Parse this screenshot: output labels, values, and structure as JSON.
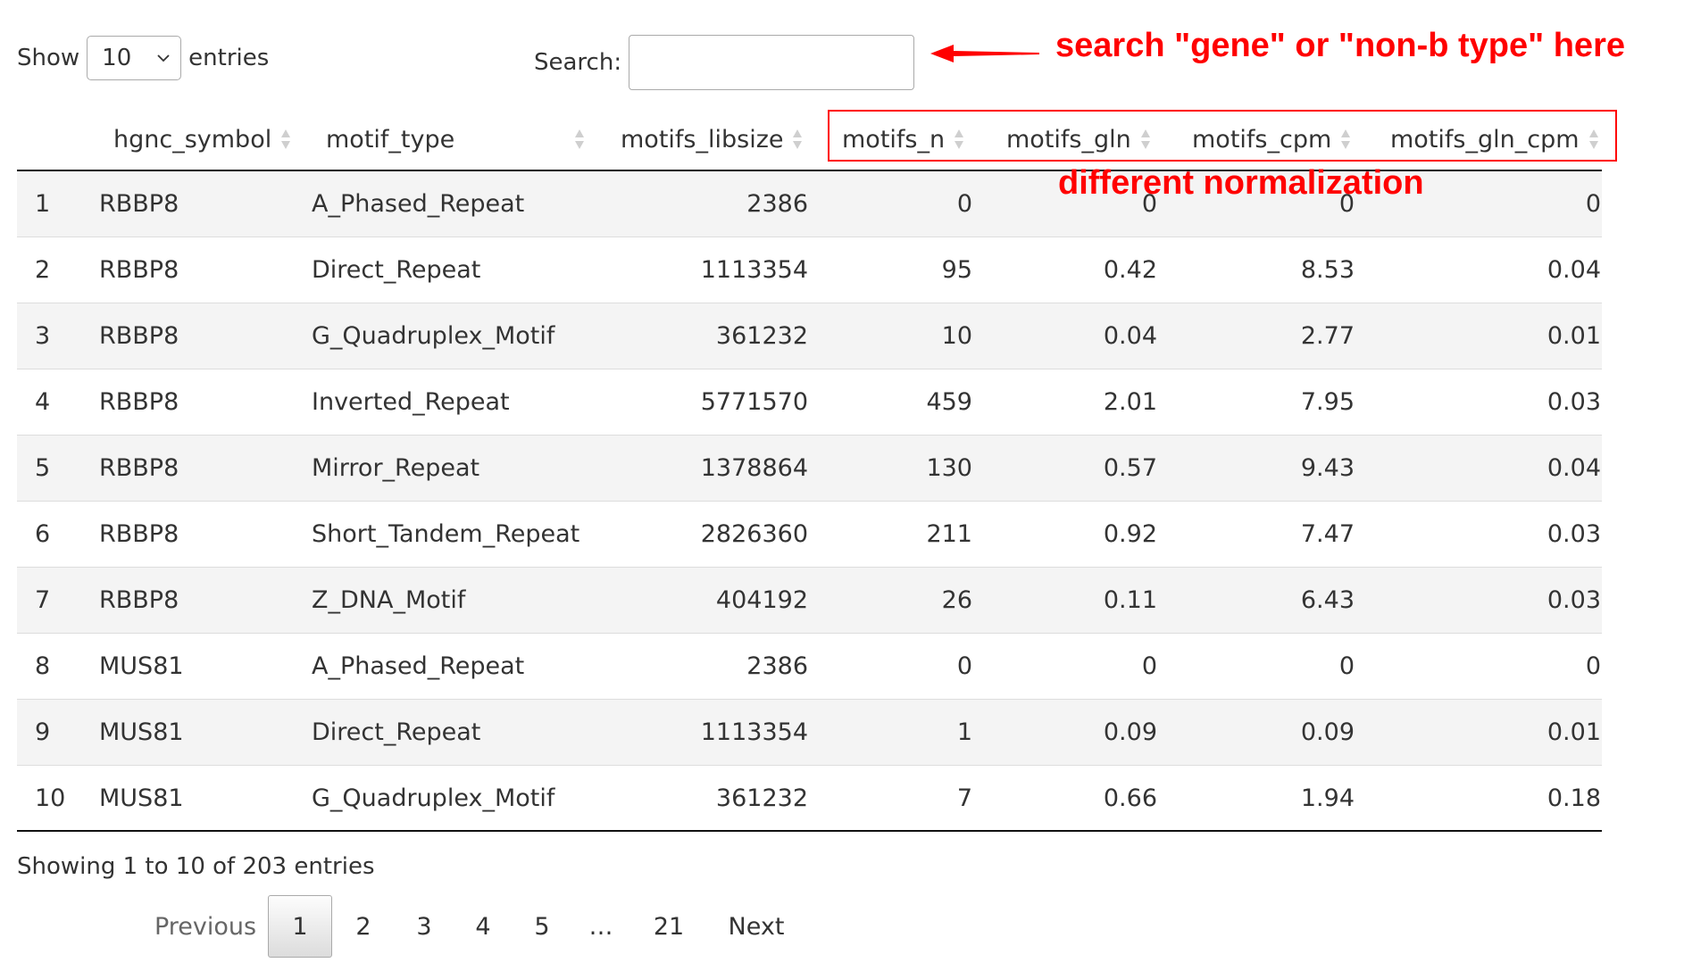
{
  "controls": {
    "show_label": "Show",
    "entries_value": "10",
    "entries_label": "entries",
    "search_label": "Search:",
    "search_value": ""
  },
  "annotations": {
    "search_note": "search \"gene\" or \"non-b type\" here",
    "normalization_note": "different normalization",
    "accent_color": "#ff0000"
  },
  "table": {
    "columns": [
      "",
      "hgnc_symbol",
      "motif_type",
      "motifs_libsize",
      "motifs_n",
      "motifs_gln",
      "motifs_cpm",
      "motifs_gln_cpm"
    ],
    "rows": [
      [
        "1",
        "RBBP8",
        "A_Phased_Repeat",
        "2386",
        "0",
        "0",
        "0",
        "0"
      ],
      [
        "2",
        "RBBP8",
        "Direct_Repeat",
        "1113354",
        "95",
        "0.42",
        "8.53",
        "0.04"
      ],
      [
        "3",
        "RBBP8",
        "G_Quadruplex_Motif",
        "361232",
        "10",
        "0.04",
        "2.77",
        "0.01"
      ],
      [
        "4",
        "RBBP8",
        "Inverted_Repeat",
        "5771570",
        "459",
        "2.01",
        "7.95",
        "0.03"
      ],
      [
        "5",
        "RBBP8",
        "Mirror_Repeat",
        "1378864",
        "130",
        "0.57",
        "9.43",
        "0.04"
      ],
      [
        "6",
        "RBBP8",
        "Short_Tandem_Repeat",
        "2826360",
        "211",
        "0.92",
        "7.47",
        "0.03"
      ],
      [
        "7",
        "RBBP8",
        "Z_DNA_Motif",
        "404192",
        "26",
        "0.11",
        "6.43",
        "0.03"
      ],
      [
        "8",
        "MUS81",
        "A_Phased_Repeat",
        "2386",
        "0",
        "0",
        "0",
        "0"
      ],
      [
        "9",
        "MUS81",
        "Direct_Repeat",
        "1113354",
        "1",
        "0.09",
        "0.09",
        "0.01"
      ],
      [
        "10",
        "MUS81",
        "G_Quadruplex_Motif",
        "361232",
        "7",
        "0.66",
        "1.94",
        "0.18"
      ]
    ]
  },
  "footer": {
    "info": "Showing 1 to 10 of 203 entries",
    "pagination": [
      "Previous",
      "1",
      "2",
      "3",
      "4",
      "5",
      "…",
      "21",
      "Next"
    ],
    "current_page": "1"
  },
  "icons": {
    "select_arrow": "chevron-down-icon",
    "sort": "sort-both-icon",
    "annotation_arrow": "arrow-left-icon"
  }
}
